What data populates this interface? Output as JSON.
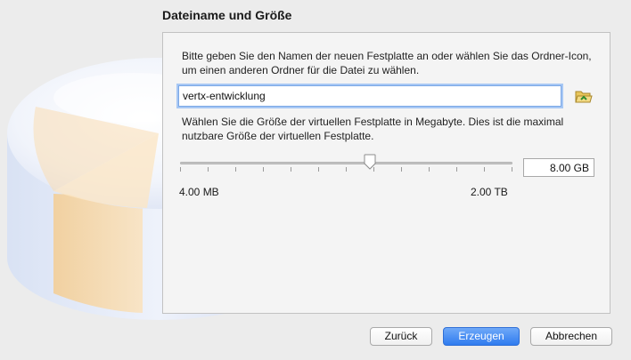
{
  "dialog": {
    "title": "Dateiname und Größe"
  },
  "file": {
    "description": "Bitte geben Sie den Namen der neuen Festplatte an oder wählen Sie das Ordner-Icon, um einen anderen Ordner für die Datei zu wählen.",
    "name_value": "vertx-entwicklung",
    "folder_icon": "folder-open-icon"
  },
  "size": {
    "description": "Wählen Sie die Größe der virtuellen Festplatte in Megabyte. Dies ist die maximal nutzbare Größe der virtuellen Festplatte.",
    "value": "8.00 GB",
    "slider_fraction": 0.57,
    "range_min": "4.00 MB",
    "range_max": "2.00 TB"
  },
  "buttons": {
    "back": "Zurück",
    "create": "Erzeugen",
    "cancel": "Abbrechen"
  },
  "colors": {
    "accent": "#2f7bef",
    "focus_ring": "#a8c8f4"
  }
}
